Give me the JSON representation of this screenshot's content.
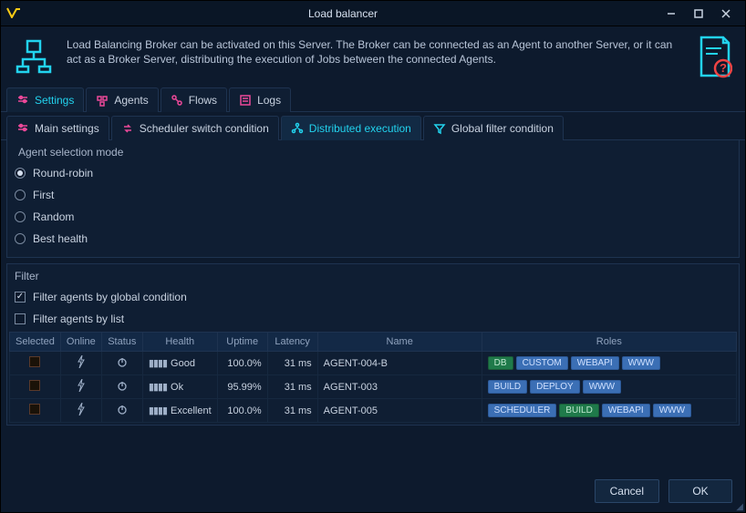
{
  "window": {
    "title": "Load balancer"
  },
  "header": {
    "text": "Load Balancing Broker can be activated on this Server. The Broker can be connected as an Agent to another Server, or it can act as a Broker Server, distributing the execution of Jobs between the connected Agents."
  },
  "tabs": {
    "settings": "Settings",
    "agents": "Agents",
    "flows": "Flows",
    "logs": "Logs"
  },
  "subtabs": {
    "main": "Main settings",
    "scheduler": "Scheduler switch condition",
    "distributed": "Distributed execution",
    "globalfilter": "Global filter condition"
  },
  "agent_mode": {
    "label": "Agent selection mode",
    "round_robin": "Round-robin",
    "first": "First",
    "random": "Random",
    "best_health": "Best health"
  },
  "filter": {
    "label": "Filter",
    "by_global": "Filter agents by global condition",
    "by_list": "Filter agents by list"
  },
  "table": {
    "cols": {
      "selected": "Selected",
      "online": "Online",
      "status": "Status",
      "health": "Health",
      "uptime": "Uptime",
      "latency": "Latency",
      "name": "Name",
      "roles": "Roles"
    },
    "rows": [
      {
        "health": "Good",
        "uptime": "100.0%",
        "latency": "31 ms",
        "name": "AGENT-004-B",
        "roles": [
          {
            "t": "DB",
            "c": "green"
          },
          {
            "t": "CUSTOM",
            "c": "blue"
          },
          {
            "t": "WEBAPI",
            "c": "blue"
          },
          {
            "t": "WWW",
            "c": "blue"
          }
        ]
      },
      {
        "health": "Ok",
        "uptime": "95.99%",
        "latency": "31 ms",
        "name": "AGENT-003",
        "roles": [
          {
            "t": "BUILD",
            "c": "blue"
          },
          {
            "t": "DEPLOY",
            "c": "blue"
          },
          {
            "t": "WWW",
            "c": "blue"
          }
        ]
      },
      {
        "health": "Excellent",
        "uptime": "100.0%",
        "latency": "31 ms",
        "name": "AGENT-005",
        "roles": [
          {
            "t": "SCHEDULER",
            "c": "blue"
          },
          {
            "t": "BUILD",
            "c": "green"
          },
          {
            "t": "WEBAPI",
            "c": "blue"
          },
          {
            "t": "WWW",
            "c": "blue"
          }
        ]
      }
    ]
  },
  "buttons": {
    "cancel": "Cancel",
    "ok": "OK"
  }
}
